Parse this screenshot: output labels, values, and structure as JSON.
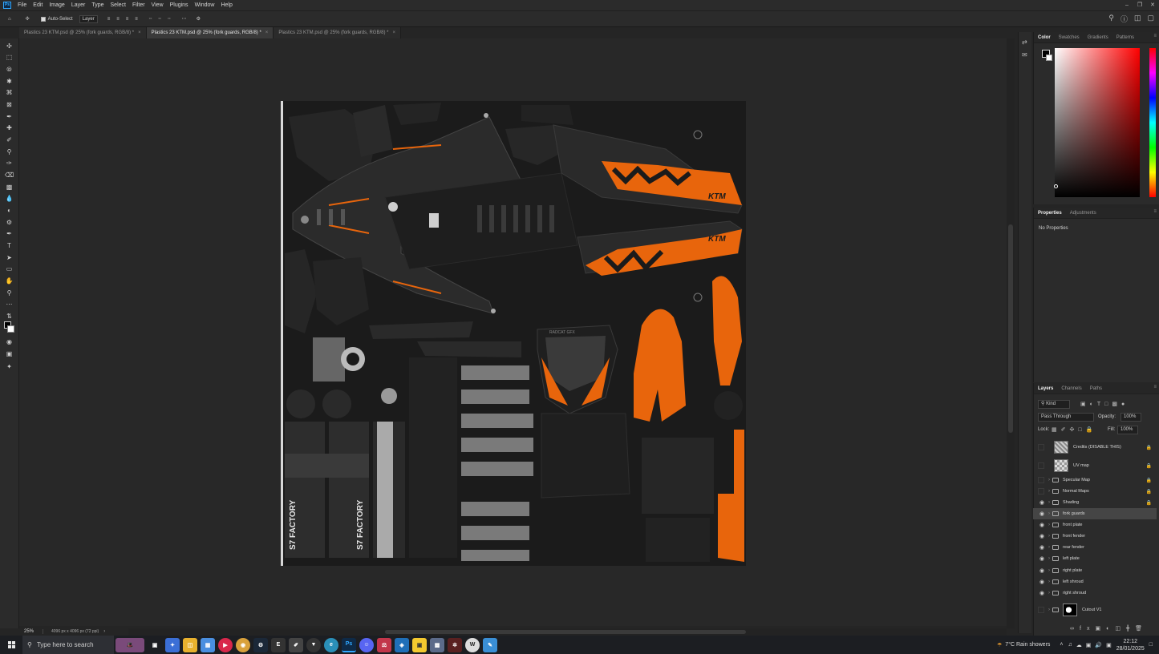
{
  "app": {
    "logo": "Ps"
  },
  "menu": {
    "items": [
      "File",
      "Edit",
      "Image",
      "Layer",
      "Type",
      "Select",
      "Filter",
      "View",
      "Plugins",
      "Window",
      "Help"
    ]
  },
  "options_bar": {
    "auto_select_label": "Auto-Select",
    "auto_select_target": "Layer"
  },
  "document_tabs": [
    {
      "title": "Plastics 23 KTM.psd @ 25% (fork guards, RGB/8) *",
      "active": false
    },
    {
      "title": "Plastics 23 KTM.psd @ 25% (fork guards, RGB/8) *",
      "active": true
    },
    {
      "title": "Plastics 23 KTM.psd @ 25% (fork guards, RGB/8) *",
      "active": false
    }
  ],
  "status_bar": {
    "zoom": "25%",
    "doc_info": "4096 px x 4096 px (72 ppi)"
  },
  "canvas_art": {
    "texts": [
      "RADCAT GFX",
      "KTM",
      "S7 FACTORY"
    ]
  },
  "color_panel": {
    "tabs": [
      "Color",
      "Swatches",
      "Gradients",
      "Patterns"
    ],
    "active_tab": "Color",
    "hue": "#ff0000"
  },
  "properties_panel": {
    "tabs": [
      "Properties",
      "Adjustments"
    ],
    "empty_text": "No Properties"
  },
  "layers_panel": {
    "tabs": [
      "Layers",
      "Channels",
      "Paths"
    ],
    "filter_label": "Kind",
    "blend_mode": "Pass Through",
    "opacity_label": "Opacity:",
    "opacity_value": "100%",
    "lock_label": "Lock:",
    "fill_label": "Fill:",
    "fill_value": "100%",
    "layers": [
      {
        "name": "Credits (DISABLE THIS)",
        "kind": "thumb",
        "visible": false,
        "locked": true,
        "selected": false
      },
      {
        "name": "UV map",
        "kind": "thumb",
        "visible": false,
        "locked": true,
        "selected": false
      },
      {
        "name": "Specular Map",
        "kind": "group",
        "visible": false,
        "locked": true,
        "selected": false
      },
      {
        "name": "Normal Maps",
        "kind": "group",
        "visible": false,
        "locked": true,
        "selected": false
      },
      {
        "name": "Shading",
        "kind": "group",
        "visible": true,
        "locked": true,
        "selected": false
      },
      {
        "name": "fork guards",
        "kind": "group",
        "visible": true,
        "locked": false,
        "selected": true
      },
      {
        "name": "front plate",
        "kind": "group",
        "visible": true,
        "locked": false,
        "selected": false
      },
      {
        "name": "front fender",
        "kind": "group",
        "visible": true,
        "locked": false,
        "selected": false
      },
      {
        "name": "rear fender",
        "kind": "group",
        "visible": true,
        "locked": false,
        "selected": false
      },
      {
        "name": "left plate",
        "kind": "group",
        "visible": true,
        "locked": false,
        "selected": false
      },
      {
        "name": "right plate",
        "kind": "group",
        "visible": true,
        "locked": false,
        "selected": false
      },
      {
        "name": "left shroud",
        "kind": "group",
        "visible": true,
        "locked": false,
        "selected": false
      },
      {
        "name": "right shroud",
        "kind": "group",
        "visible": true,
        "locked": false,
        "selected": false
      },
      {
        "name": "Cutout V1",
        "kind": "mask-group",
        "visible": false,
        "locked": false,
        "selected": false
      }
    ]
  },
  "taskbar": {
    "search_placeholder": "Type here to search",
    "weather": "7°C  Rain showers",
    "time": "22:12",
    "date": "28/01/2025"
  },
  "colors": {
    "accent_orange": "#e8650c",
    "ps_blue": "#31a8ff"
  }
}
